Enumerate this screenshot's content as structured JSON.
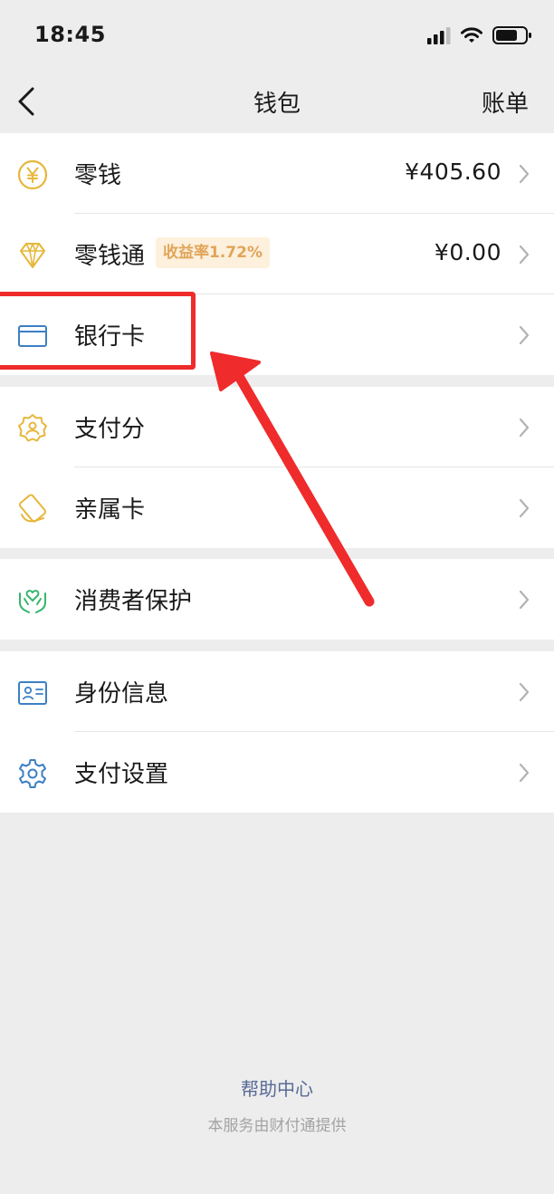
{
  "status_bar": {
    "time": "18:45"
  },
  "nav": {
    "title": "钱包",
    "right_action": "账单"
  },
  "group1": [
    {
      "label": "零钱",
      "value": "¥405.60",
      "icon": "yen-coin-icon"
    },
    {
      "label": "零钱通",
      "badge": "收益率1.72%",
      "value": "¥0.00",
      "icon": "diamond-icon"
    },
    {
      "label": "银行卡",
      "icon": "bank-card-icon"
    }
  ],
  "group2": [
    {
      "label": "支付分",
      "icon": "score-badge-icon"
    },
    {
      "label": "亲属卡",
      "icon": "family-card-icon"
    }
  ],
  "group3": [
    {
      "label": "消费者保护",
      "icon": "protection-hands-icon"
    }
  ],
  "group4": [
    {
      "label": "身份信息",
      "icon": "id-card-icon"
    },
    {
      "label": "支付设置",
      "icon": "gear-icon"
    }
  ],
  "footer": {
    "help_link": "帮助中心",
    "note": "本服务由财付通提供"
  },
  "colors": {
    "accent_link": "#576b95",
    "highlight_red": "#ef2b2b",
    "badge_text": "#e0a55a",
    "icon_gold": "#e7b73a",
    "icon_blue": "#3c7fc4",
    "icon_green": "#35b56b"
  }
}
